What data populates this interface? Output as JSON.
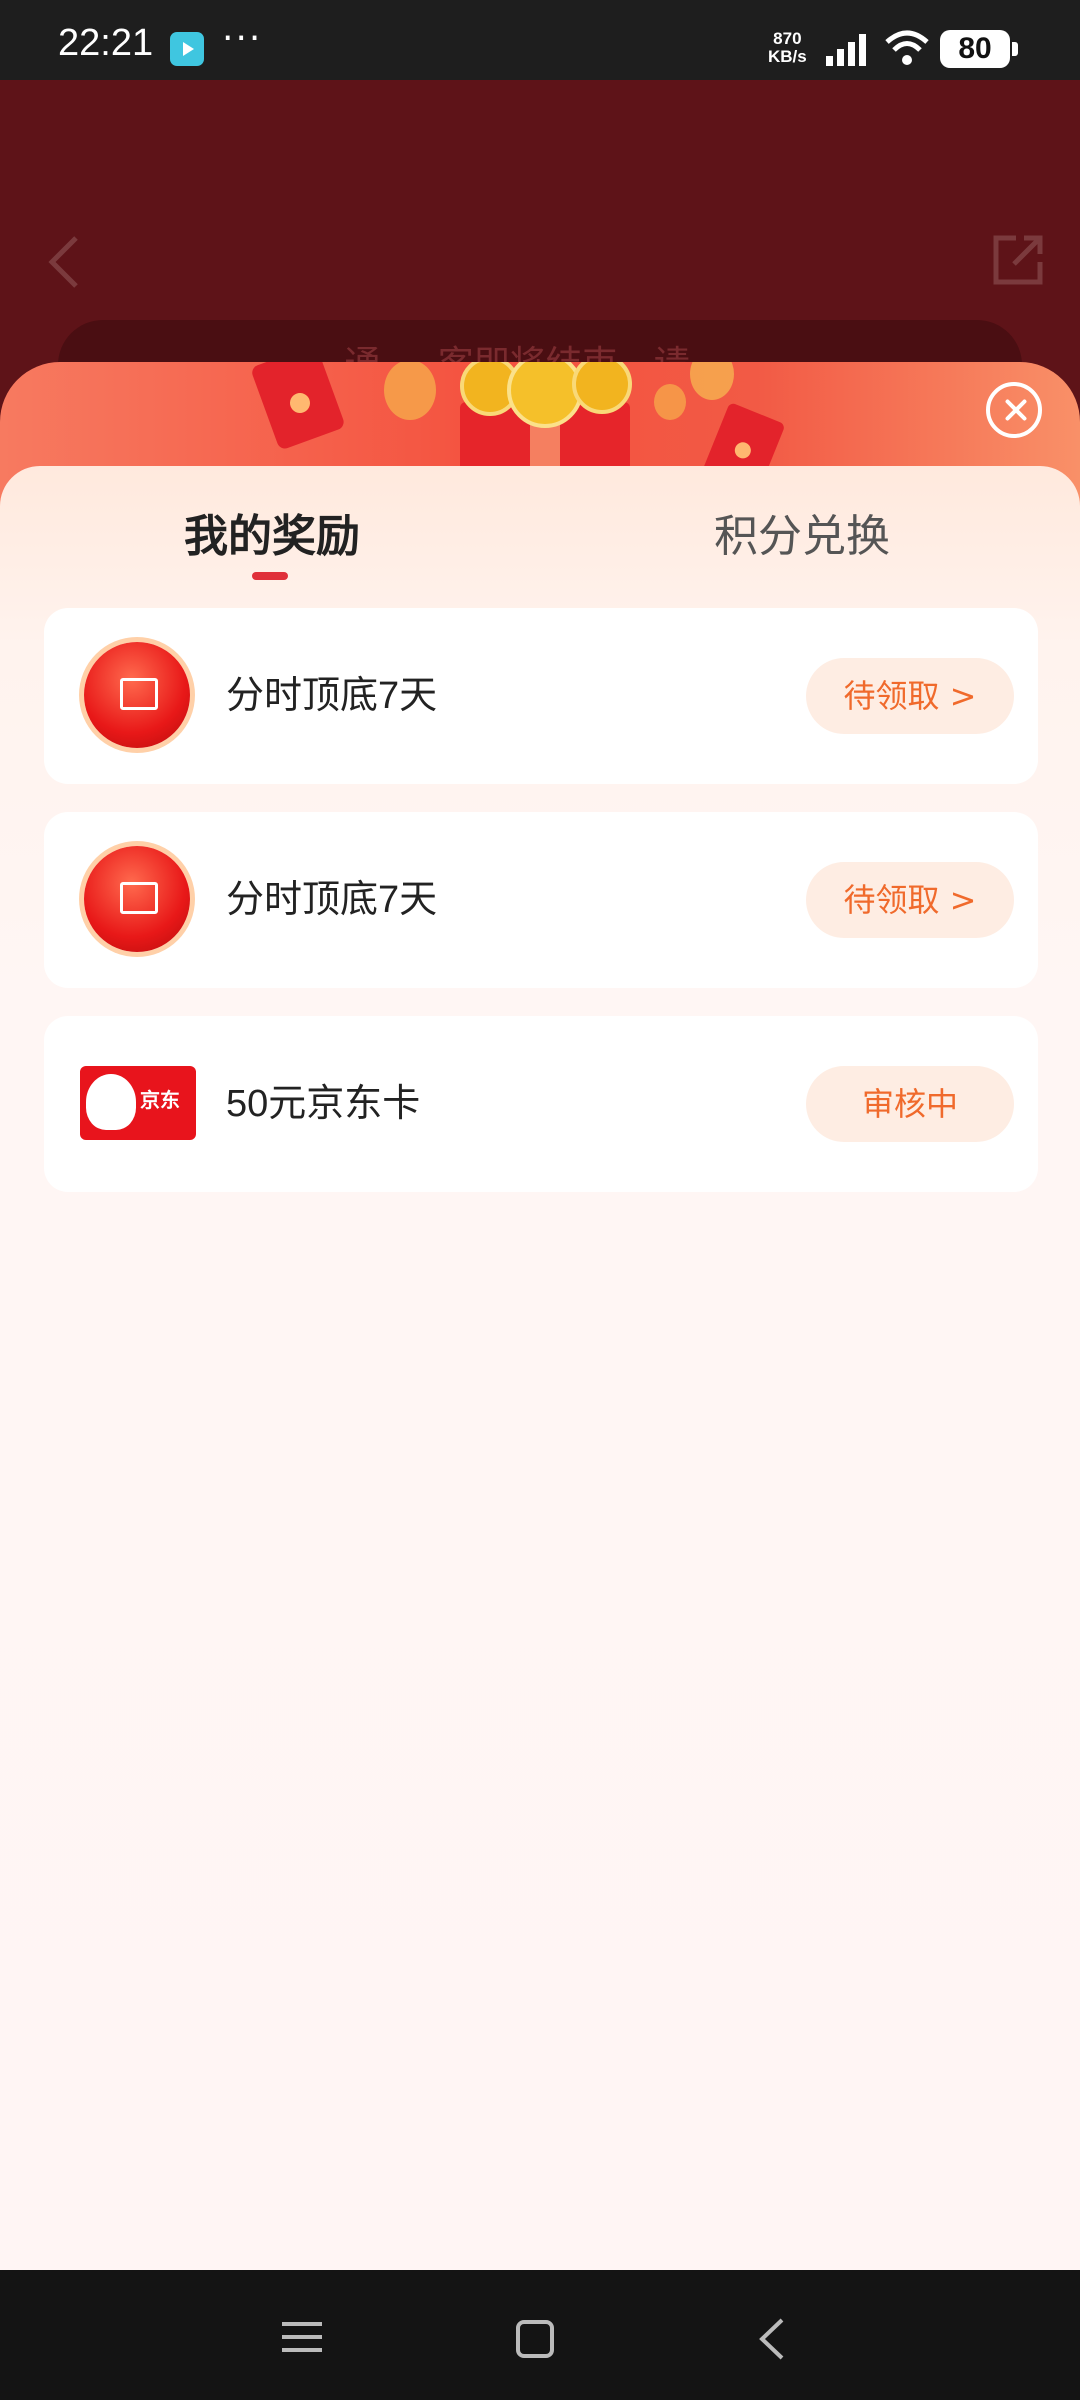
{
  "status_bar": {
    "time": "22:21",
    "dots": "···",
    "net_speed_value": "870",
    "net_speed_unit": "KB/s",
    "battery": "80"
  },
  "background": {
    "notice_text": "通 ... 客即将结束，请 ..."
  },
  "tabs": [
    {
      "label": "我的奖励",
      "active": true
    },
    {
      "label": "积分兑换",
      "active": false
    }
  ],
  "rewards": [
    {
      "title": "分时顶底7天",
      "action": "待领取 >",
      "icon": "chart-icon"
    },
    {
      "title": "分时顶底7天",
      "action": "待领取 >",
      "icon": "chart-icon"
    },
    {
      "title": "50元京东卡",
      "action": "审核中",
      "icon": "jd-card-icon",
      "card_text": "京东"
    }
  ],
  "colors": {
    "accent": "#e0303a",
    "action_text": "#f06a2c",
    "action_bg": "#feede3"
  }
}
